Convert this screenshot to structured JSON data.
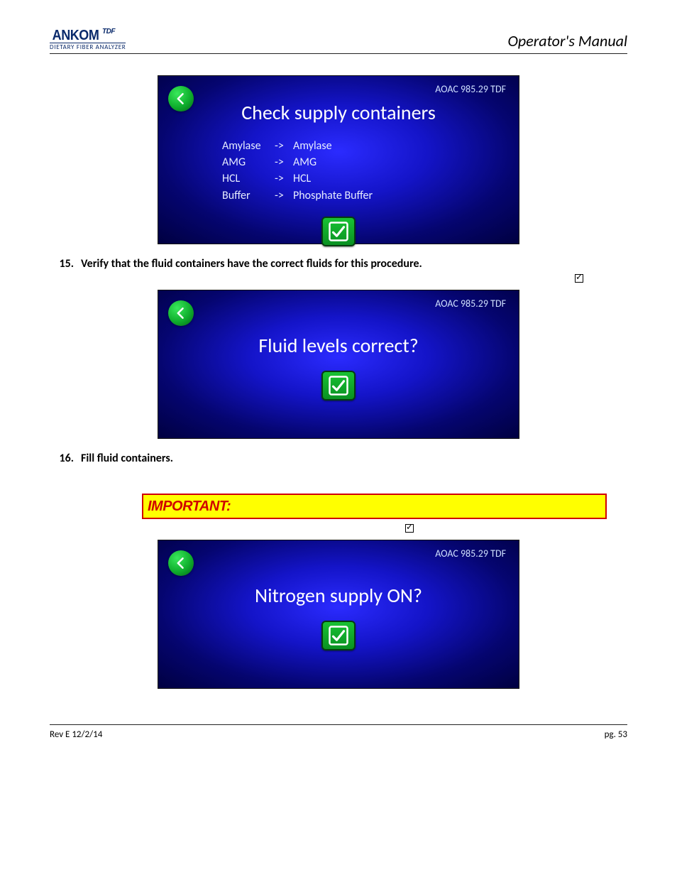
{
  "header": {
    "brand_main": "ANKOM",
    "brand_sup": "TDF",
    "brand_sub": "DIETARY FIBER ANALYZER",
    "manual_title": "Operator's Manual"
  },
  "screens": {
    "s1": {
      "aoac": "AOAC 985.29 TDF",
      "title": "Check supply containers",
      "rows": [
        {
          "c1": "Amylase",
          "arr": "->",
          "c2": "Amylase"
        },
        {
          "c1": "AMG",
          "arr": "->",
          "c2": "AMG"
        },
        {
          "c1": "HCL",
          "arr": "->",
          "c2": "HCL"
        },
        {
          "c1": "Buffer",
          "arr": "->",
          "c2": "Phosphate Buffer"
        }
      ]
    },
    "s2": {
      "aoac": "AOAC 985.29 TDF",
      "title": "Fluid levels correct?"
    },
    "s3": {
      "aoac": "AOAC 985.29 TDF",
      "title": "Nitrogen supply ON?"
    }
  },
  "steps": {
    "n15": "15.",
    "t15": "Verify that the fluid containers have the correct fluids for this procedure.",
    "n16": "16.",
    "t16": "Fill fluid containers."
  },
  "important_label": "IMPORTANT:",
  "footer": {
    "rev": "Rev E 12/2/14",
    "page": "pg. 53"
  }
}
